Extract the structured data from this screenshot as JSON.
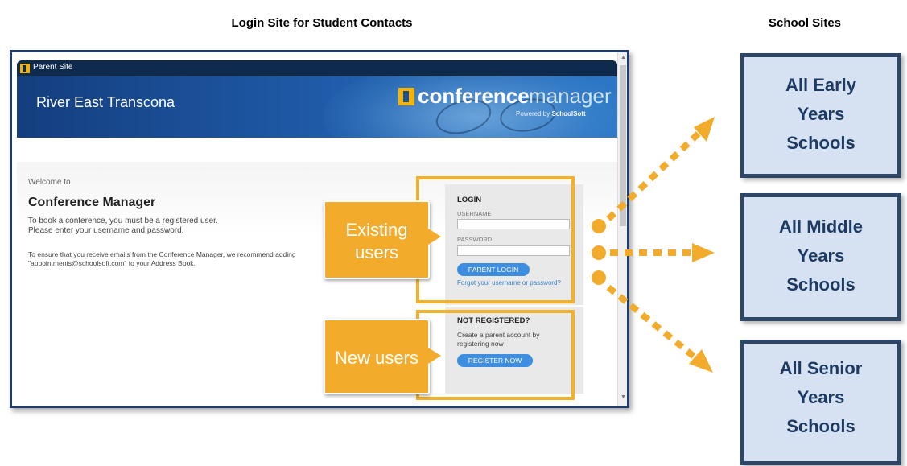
{
  "headings": {
    "left": "Login Site for Student Contacts",
    "right": "School Sites"
  },
  "browser": {
    "tab_label": "Parent Site",
    "district": "River East Transcona",
    "logo_part1": "conference",
    "logo_part2": "manager",
    "powered_by_prefix": "Powered by ",
    "powered_by_brand": "SchoolSoft"
  },
  "content": {
    "welcome": "Welcome to",
    "title": "Conference Manager",
    "intro_line1": "To book a conference, you must be a registered user.",
    "intro_line2": "Please enter your username and password.",
    "ensure_line1": "To ensure that you receive emails from the Conference Manager, we recommend adding",
    "ensure_line2": "\"appointments@schoolsoft.com\" to your Address Book."
  },
  "login": {
    "heading": "LOGIN",
    "username_label": "USERNAME",
    "password_label": "PASSWORD",
    "button": "PARENT LOGIN",
    "forgot_link": "Forgot your username or password?"
  },
  "register": {
    "heading": "NOT REGISTERED?",
    "line1": "Create a parent account by",
    "line2": "registering now",
    "button": "REGISTER NOW"
  },
  "callouts": {
    "existing_line1": "Existing",
    "existing_line2": "users",
    "new": "New users"
  },
  "schools": {
    "early": [
      "All Early",
      "Years",
      "Schools"
    ],
    "middle": [
      "All Middle",
      "Years",
      "Schools"
    ],
    "senior": [
      "All Senior",
      "Years",
      "Schools"
    ]
  },
  "colors": {
    "frame": "#1f3d68",
    "accent_orange": "#f2ab2a",
    "school_fill": "#d6e2f2",
    "school_border": "#2f4766",
    "button_blue": "#3d8de0"
  }
}
